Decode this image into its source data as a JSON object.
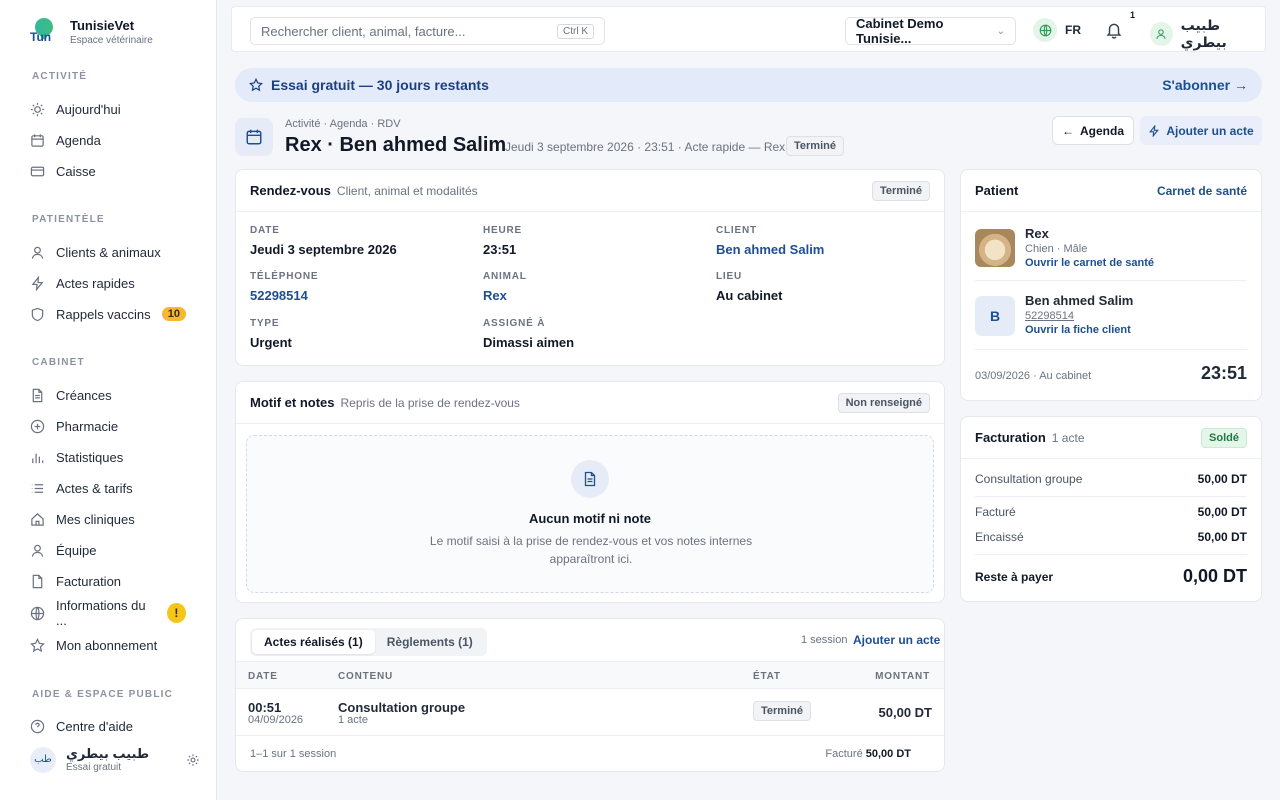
{
  "brand": {
    "name": "TunisieVet",
    "subtitle": "Espace vétérinaire",
    "logo_text": "Tun"
  },
  "sidebar": {
    "sections": [
      "ACTIVITÉ",
      "PATIENTÈLE",
      "CABINET",
      "AIDE & ESPACE PUBLIC"
    ],
    "items": [
      {
        "label": "Aujourd'hui",
        "icon": "sun-icon"
      },
      {
        "label": "Agenda",
        "icon": "calendar-icon"
      },
      {
        "label": "Caisse",
        "icon": "card-icon"
      },
      {
        "label": "Clients & animaux",
        "icon": "user-icon"
      },
      {
        "label": "Actes rapides",
        "icon": "bolt-icon"
      },
      {
        "label": "Rappels vaccins",
        "icon": "shield-icon",
        "badge": "10"
      },
      {
        "label": "Créances",
        "icon": "document-icon"
      },
      {
        "label": "Pharmacie",
        "icon": "plus-circle-icon"
      },
      {
        "label": "Statistiques",
        "icon": "bar-chart-icon"
      },
      {
        "label": "Actes & tarifs",
        "icon": "list-icon"
      },
      {
        "label": "Mes cliniques",
        "icon": "home-icon"
      },
      {
        "label": "Équipe",
        "icon": "user-icon"
      },
      {
        "label": "Facturation",
        "icon": "file-icon"
      },
      {
        "label": "Informations du ...",
        "icon": "globe-icon",
        "warn": "!"
      },
      {
        "label": "Mon abonnement",
        "icon": "star-icon"
      },
      {
        "label": "Centre d'aide",
        "icon": "help-icon"
      }
    ],
    "user": {
      "avatar": "طب",
      "name": "طبيب بيطري",
      "plan": "Essai gratuit"
    }
  },
  "topbar": {
    "search_placeholder": "Rechercher client, animal, facture...",
    "search_shortcut": "Ctrl K",
    "clinic": "Cabinet Demo Tunisie...",
    "lang": "FR",
    "notif_count": "1",
    "user_name": "طبيب بيطري"
  },
  "trial": {
    "text": "Essai gratuit — 30 jours restants",
    "cta": "S'abonner →"
  },
  "page": {
    "breadcrumb": "Activité · Agenda · RDV",
    "title": "Rex · Ben ahmed Salim",
    "subtitle": "Jeudi 3 septembre 2026 · 23:51 · Acte rapide — Rex",
    "status": "Terminé",
    "btn_agenda": "Agenda",
    "btn_add": "Ajouter un acte"
  },
  "rdv": {
    "title": "Rendez-vous",
    "subtitle": "Client, animal et modalités",
    "status": "Terminé",
    "fields": {
      "date_label": "DATE",
      "date": "Jeudi 3 septembre 2026",
      "heure_label": "HEURE",
      "heure": "23:51",
      "client_label": "CLIENT",
      "client": "Ben ahmed Salim",
      "tel_label": "TÉLÉPHONE",
      "tel": "52298514",
      "animal_label": "ANIMAL",
      "animal": "Rex",
      "lieu_label": "LIEU",
      "lieu": "Au cabinet",
      "type_label": "TYPE",
      "type": "Urgent",
      "assigne_label": "ASSIGNÉ À",
      "assigne": "Dimassi aimen"
    }
  },
  "motif": {
    "title": "Motif et notes",
    "subtitle": "Repris de la prise de rendez-vous",
    "status": "Non renseigné",
    "empty_title": "Aucun motif ni note",
    "empty_desc": "Le motif saisi à la prise de rendez-vous et vos notes internes apparaîtront ici."
  },
  "actes": {
    "tabs": [
      "Actes réalisés (1)",
      "Règlements (1)"
    ],
    "session_count": "1 session",
    "add_link": "Ajouter un acte",
    "columns": [
      "DATE",
      "CONTENU",
      "ÉTAT",
      "MONTANT"
    ],
    "rows": [
      {
        "time": "00:51",
        "date": "04/09/2026",
        "content": "Consultation groupe",
        "sub": "1 acte",
        "state": "Terminé",
        "amount": "50,00 DT"
      }
    ],
    "footer_left": "1–1 sur 1 session",
    "footer_label": "Facturé",
    "footer_amount": "50,00 DT"
  },
  "patient": {
    "title": "Patient",
    "link": "Carnet de santé",
    "animal_name": "Rex",
    "animal_info": "Chien · Mâle",
    "animal_link": "Ouvrir le carnet de santé",
    "owner_initial": "B",
    "owner_name": "Ben ahmed Salim",
    "owner_phone": "52298514",
    "owner_link": "Ouvrir la fiche client",
    "footer_left": "03/09/2026 · Au cabinet",
    "footer_time": "23:51"
  },
  "billing": {
    "title": "Facturation",
    "subtitle": "1 acte",
    "status": "Soldé",
    "line_label": "Consultation groupe",
    "line_amount": "50,00 DT",
    "facture_label": "Facturé",
    "facture_amount": "50,00 DT",
    "encaisse_label": "Encaissé",
    "encaisse_amount": "50,00 DT",
    "reste_label": "Reste à payer",
    "reste_amount": "0,00 DT"
  }
}
